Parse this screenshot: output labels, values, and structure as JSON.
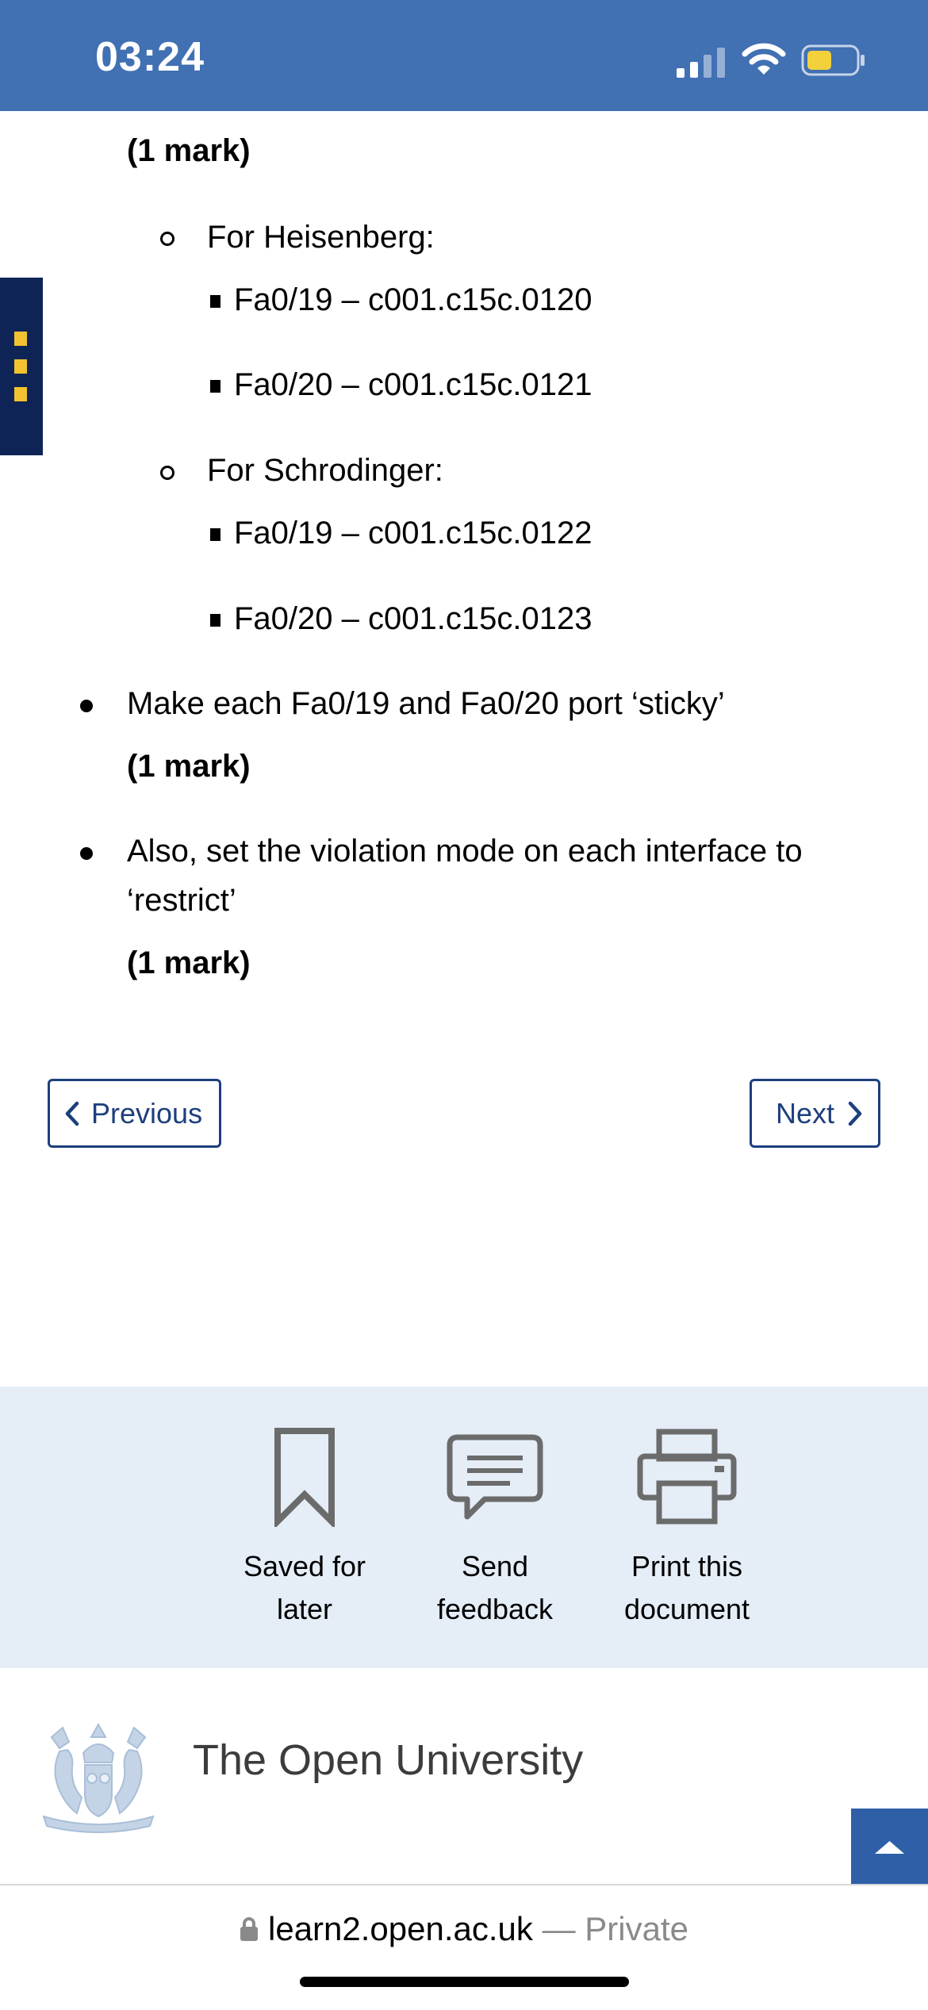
{
  "status_bar": {
    "time": "03:24",
    "battery_color": "#f2d13c"
  },
  "content": {
    "mark_top": "(1 mark)",
    "heisenberg": {
      "label": "For Heisenberg:",
      "items": [
        "Fa0/19 – c001.c15c.0120",
        "Fa0/20 – c001.c15c.0121"
      ]
    },
    "schrodinger": {
      "label": "For Schrodinger:",
      "items": [
        "Fa0/19 – c001.c15c.0122",
        "Fa0/20 – c001.c15c.0123"
      ]
    },
    "bullets": [
      {
        "text": "Make each Fa0/19 and Fa0/20 port ‘sticky’",
        "mark": "(1 mark)"
      },
      {
        "text_lines": [
          "Also, set the violation mode on each interface to",
          "‘restrict’"
        ],
        "mark": "(1 mark)"
      }
    ]
  },
  "nav": {
    "previous_label": "Previous",
    "next_label": "Next"
  },
  "actions": [
    {
      "icon": "bookmark-icon",
      "lines": [
        "Saved for",
        "later"
      ]
    },
    {
      "icon": "speech-bubble-icon",
      "lines": [
        "Send",
        "feedback"
      ]
    },
    {
      "icon": "printer-icon",
      "lines": [
        "Print this",
        "document"
      ]
    }
  ],
  "footer": {
    "university": "The Open University",
    "back_to_top_icon": "triangle-up-icon"
  },
  "browser": {
    "domain": "learn2.open.ac.uk",
    "suffix": " — Private",
    "lock_icon": "lock-icon"
  },
  "colors": {
    "header_blue": "#4170b3",
    "nav_blue": "#1d3f7d",
    "side_tab": "#0e2457",
    "side_tab_dots": "#f2c230",
    "actions_bg": "#e5edf7",
    "back_to_top": "#2f5fa7"
  }
}
